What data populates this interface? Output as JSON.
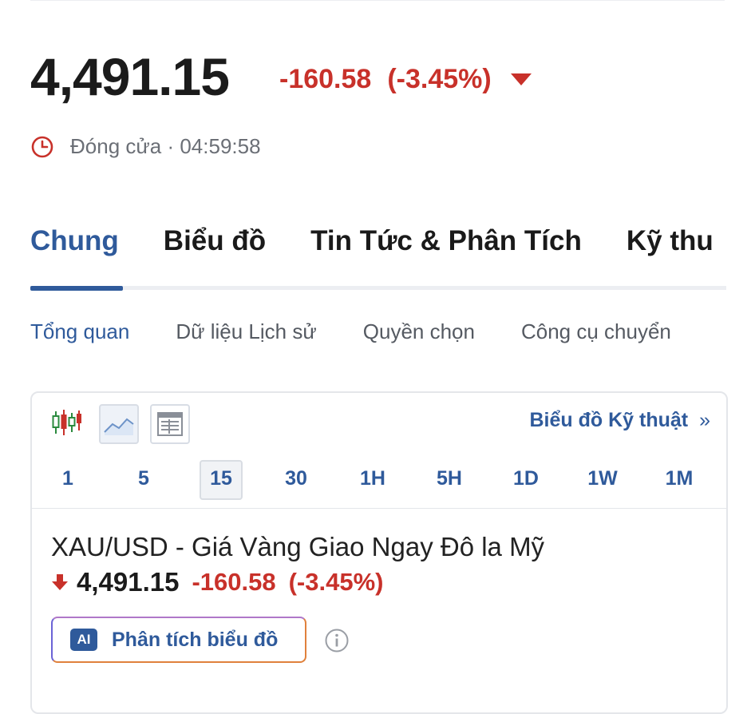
{
  "quote": {
    "price": "4,491.15",
    "change": "-160.58",
    "change_pct": "(-3.45%)",
    "direction_icon": "caret-down-icon",
    "status_text": "Đóng cửa · 04:59:58",
    "status_icon": "clock-icon",
    "down_color": "#c8312a"
  },
  "tabs": [
    {
      "label": "Chung",
      "active": true
    },
    {
      "label": "Biểu đồ",
      "active": false
    },
    {
      "label": "Tin Tức & Phân Tích",
      "active": false
    },
    {
      "label": "Kỹ thu",
      "active": false
    }
  ],
  "subtabs": [
    {
      "label": "Tổng quan",
      "active": true
    },
    {
      "label": "Dữ liệu Lịch sử",
      "active": false
    },
    {
      "label": "Quyền chọn",
      "active": false
    },
    {
      "label": "Công cụ chuyển",
      "active": false
    }
  ],
  "chart_widget": {
    "type_icons": [
      "candlestick-icon",
      "line-chart-icon",
      "table-icon"
    ],
    "tech_link": "Biểu đồ Kỹ thuật",
    "tech_link_chevron": "»",
    "intervals": [
      "1",
      "5",
      "15",
      "30",
      "1H",
      "5H",
      "1D",
      "1W",
      "1M"
    ],
    "active_interval": "15"
  },
  "instrument": {
    "name": "XAU/USD - Giá Vàng Giao Ngay Đô la Mỹ",
    "price": "4,491.15",
    "change": "-160.58",
    "change_pct": "(-3.45%)"
  },
  "ai_button": {
    "badge": "AI",
    "label": "Phân tích biểu đồ"
  },
  "accent_color": "#2f5a9b"
}
